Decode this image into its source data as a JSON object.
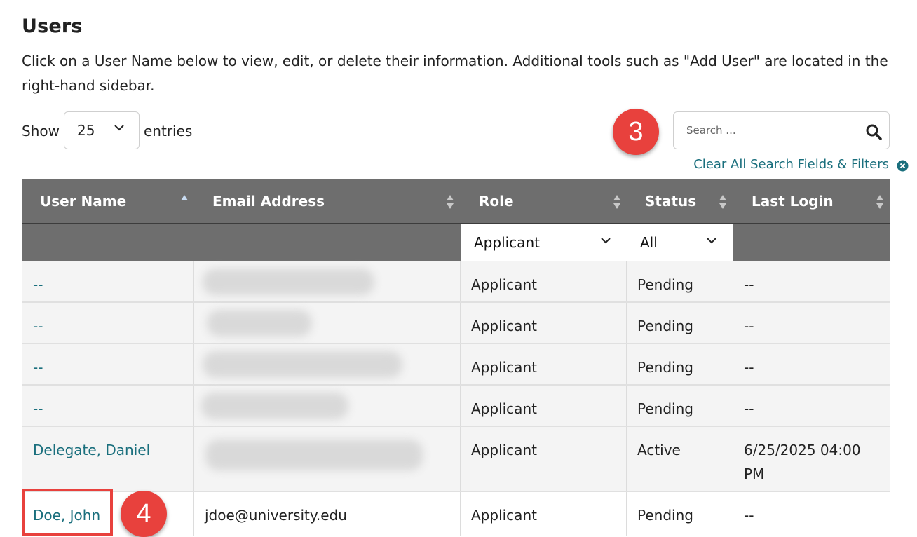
{
  "page": {
    "title": "Users",
    "intro": "Click on a User Name below to view, edit, or delete their information. Additional tools such as \"Add User\" are located in the right-hand sidebar."
  },
  "length_menu": {
    "show_label": "Show",
    "value": "25",
    "entries_label": "entries"
  },
  "search": {
    "placeholder": "Search ...",
    "icon": "search-icon",
    "clear_label": "Clear All Search Fields & Filters",
    "clear_icon": "close-circle-icon"
  },
  "annotations": {
    "step_a": "3",
    "step_b": "4",
    "color": "#e8413d"
  },
  "table": {
    "columns": [
      "User Name",
      "Email Address",
      "Role",
      "Status",
      "Last Login"
    ],
    "filters": {
      "role": "Applicant",
      "status": "All"
    },
    "rows": [
      {
        "user": "--",
        "email": "",
        "role": "Applicant",
        "status": "Pending",
        "last_login": "--"
      },
      {
        "user": "--",
        "email": "",
        "role": "Applicant",
        "status": "Pending",
        "last_login": "--"
      },
      {
        "user": "--",
        "email": "",
        "role": "Applicant",
        "status": "Pending",
        "last_login": "--"
      },
      {
        "user": "--",
        "email": "",
        "role": "Applicant",
        "status": "Pending",
        "last_login": "--"
      },
      {
        "user": "Delegate, Daniel",
        "email": "",
        "role": "Applicant",
        "status": "Active",
        "last_login": "6/25/2025 04:00 PM"
      },
      {
        "user": "Doe, John",
        "email": "jdoe@university.edu",
        "role": "Applicant",
        "status": "Pending",
        "last_login": "--"
      }
    ]
  },
  "colors": {
    "header_bg": "#6e6e6e",
    "link": "#1a6f7d",
    "row_bg": "#f4f4f4"
  }
}
